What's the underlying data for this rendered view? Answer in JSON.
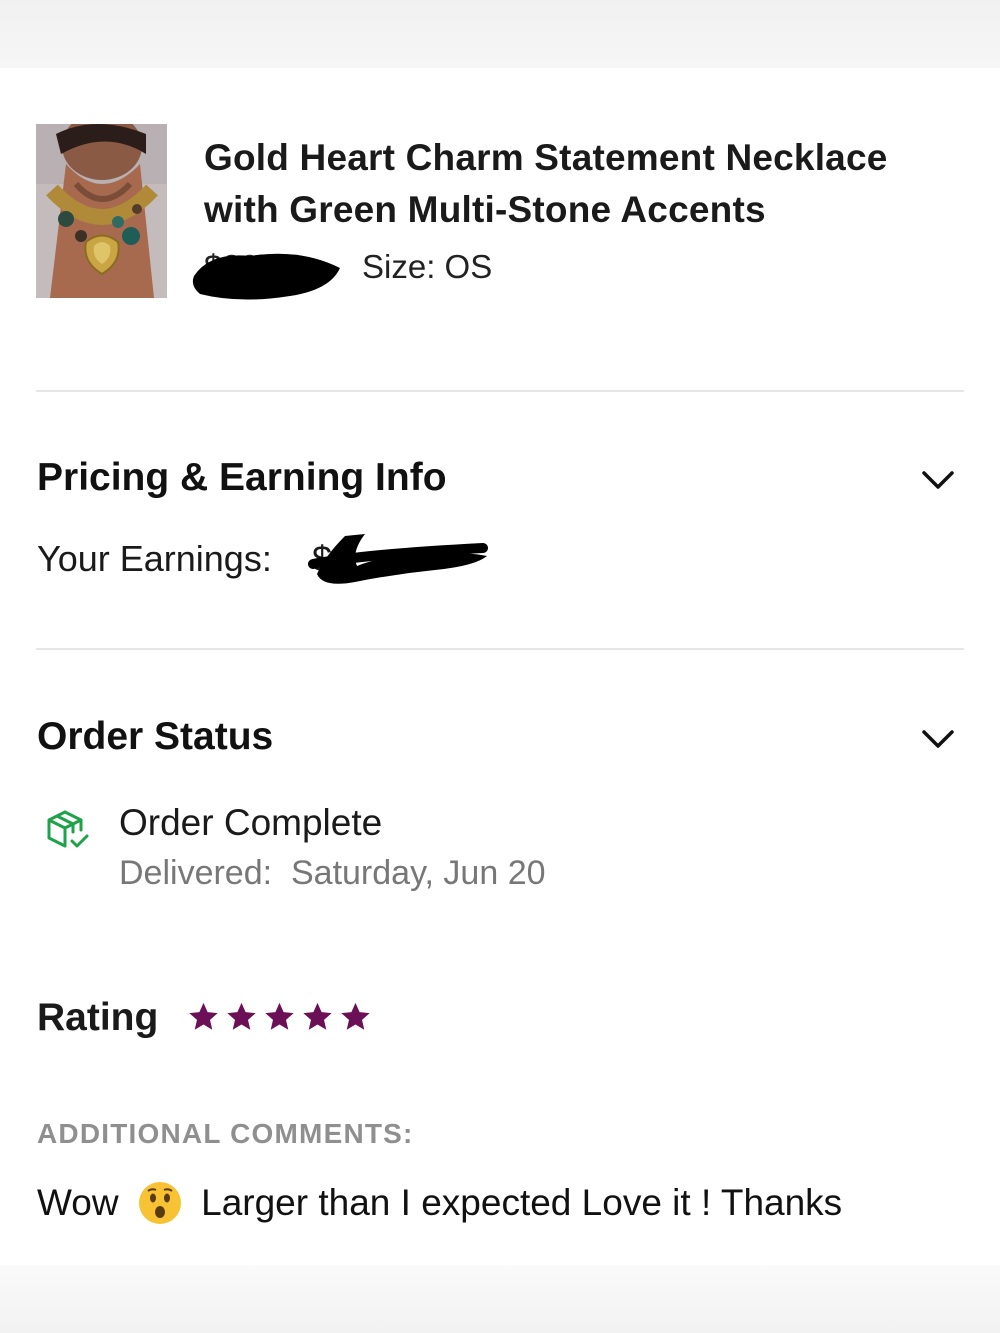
{
  "product": {
    "title_line1": "Gold Heart Charm Statement Necklace",
    "title_line2": "with Green Multi-Stone Accents",
    "price": "$29.00",
    "size": "Size: OS",
    "image_icon": "necklace-product-photo"
  },
  "pricing": {
    "title": "Pricing & Earning Info",
    "earnings_label": "Your Earnings:",
    "earnings_value": "$"
  },
  "order_status": {
    "title": "Order Status",
    "status": "Order Complete",
    "delivered_label": "Delivered:",
    "delivered_date": "Saturday, Jun 20",
    "icon": "package-check-icon",
    "icon_color": "#1fa34a"
  },
  "rating": {
    "title": "Rating",
    "stars": 5,
    "max_stars": 5,
    "star_color": "#6b0f57"
  },
  "comments": {
    "label": "ADDITIONAL COMMENTS:",
    "text_before_emoji": "Wow",
    "emoji": "surprised-face-emoji",
    "text_after_emoji": "Larger than I expected Love it ! Thanks"
  },
  "colors": {
    "divider": "#e6e6e6",
    "muted_text": "#777777",
    "label_gray": "#8f8f8f"
  }
}
